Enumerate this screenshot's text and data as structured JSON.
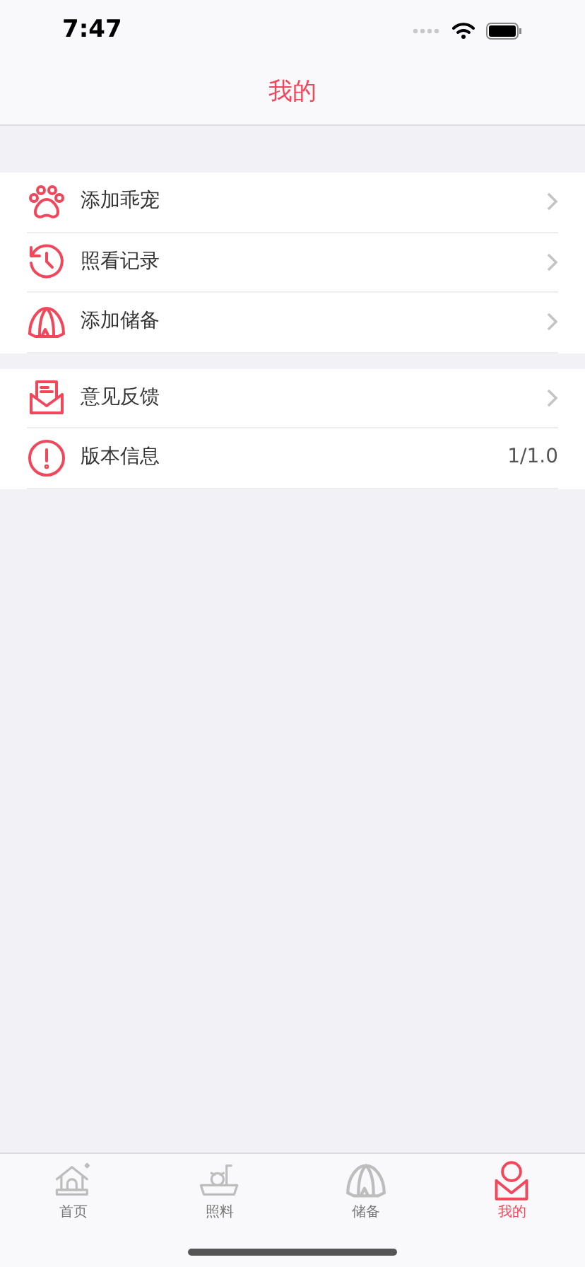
{
  "status_bar": {
    "time": "7:47"
  },
  "nav": {
    "title": "我的"
  },
  "groups": [
    {
      "rows": [
        {
          "label": "添加乖宠",
          "kind": "link"
        },
        {
          "label": "照看记录",
          "kind": "link"
        },
        {
          "label": "添加储备",
          "kind": "link"
        }
      ]
    },
    {
      "rows": [
        {
          "label": "意见反馈",
          "kind": "link"
        },
        {
          "label": "版本信息",
          "kind": "value",
          "value": "1/1.0"
        }
      ]
    }
  ],
  "tab_bar": [
    {
      "label": "首页",
      "selected": false
    },
    {
      "label": "照料",
      "selected": false
    },
    {
      "label": "储备",
      "selected": false
    },
    {
      "label": "我的",
      "selected": true
    }
  ]
}
